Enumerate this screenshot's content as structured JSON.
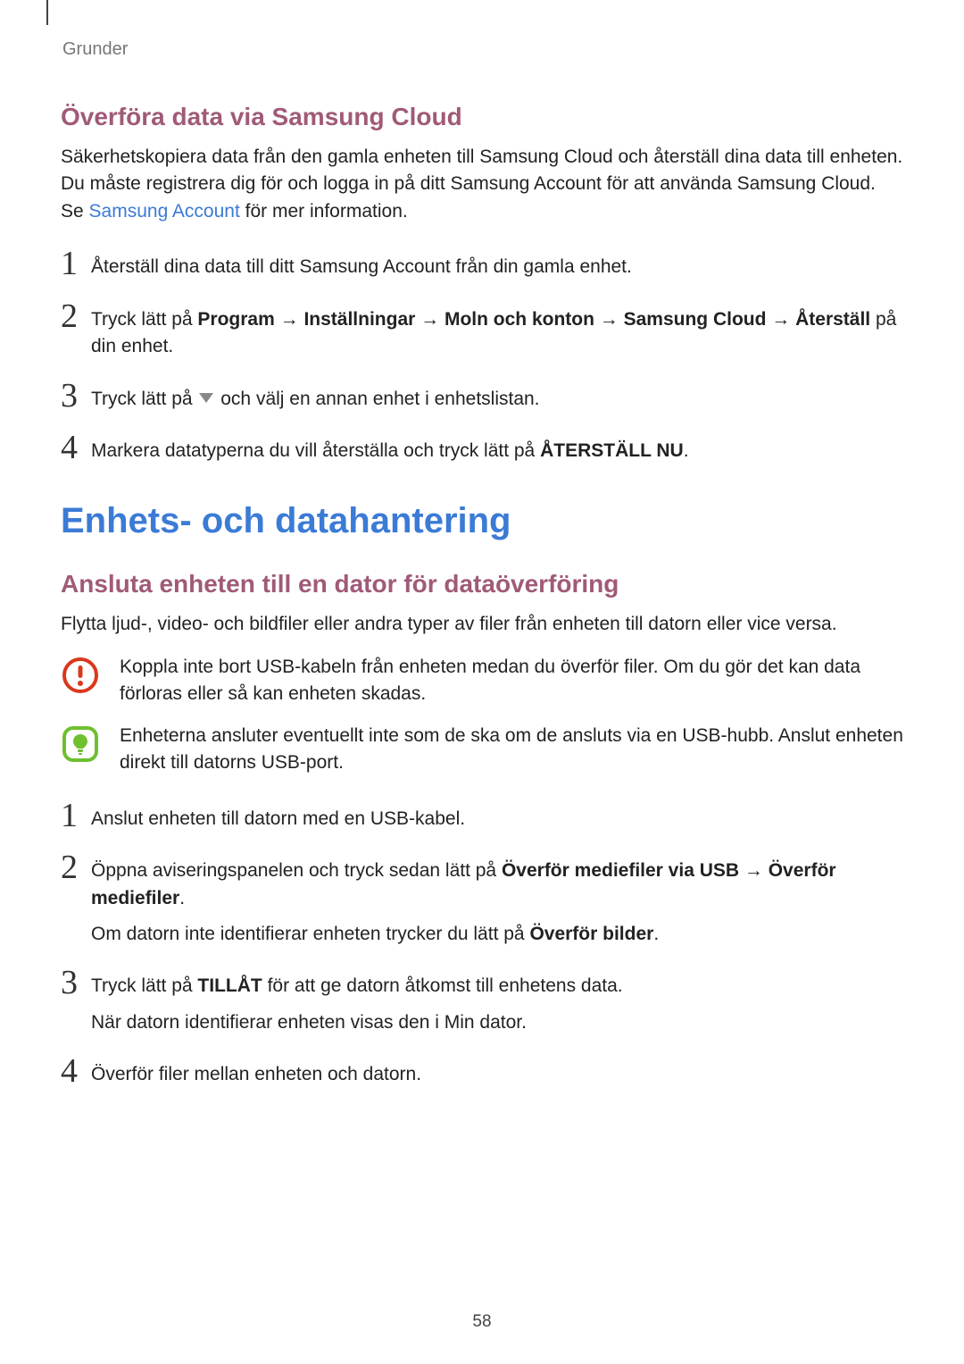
{
  "breadcrumb": "Grunder",
  "section1": {
    "heading": "Överföra data via Samsung Cloud",
    "intro_part1": "Säkerhetskopiera data från den gamla enheten till Samsung Cloud och återställ dina data till enheten. Du måste registrera dig för och logga in på ditt Samsung Account för att använda Samsung Cloud. Se ",
    "intro_link": "Samsung Account",
    "intro_part2": " för mer information.",
    "steps": {
      "s1": "Återställ dina data till ditt Samsung Account från din gamla enhet.",
      "s2_pre": "Tryck lätt på ",
      "s2_bold": "Program → Inställningar → Moln och konton → Samsung Cloud → Återställ",
      "s2_post": " på din enhet.",
      "s3_pre": "Tryck lätt på ",
      "s3_post": " och välj en annan enhet i enhetslistan.",
      "s4_pre": "Markera datatyperna du vill återställa och tryck lätt på ",
      "s4_bold": "ÅTERSTÄLL NU",
      "s4_post": "."
    }
  },
  "mainHeading": "Enhets- och datahantering",
  "section2": {
    "heading": "Ansluta enheten till en dator för dataöverföring",
    "intro": "Flytta ljud-, video- och bildfiler eller andra typer av filer från enheten till datorn eller vice versa.",
    "warning": "Koppla inte bort USB-kabeln från enheten medan du överför filer. Om du gör det kan data förloras eller så kan enheten skadas.",
    "note": "Enheterna ansluter eventuellt inte som de ska om de ansluts via en USB-hubb. Anslut enheten direkt till datorns USB-port.",
    "steps": {
      "s1": "Anslut enheten till datorn med en USB-kabel.",
      "s2_pre": "Öppna aviseringspanelen och tryck sedan lätt på ",
      "s2_bold": "Överför mediefiler via USB → Överför mediefiler",
      "s2_post": ".",
      "s2_extra_pre": "Om datorn inte identifierar enheten trycker du lätt på ",
      "s2_extra_bold": "Överför bilder",
      "s2_extra_post": ".",
      "s3_pre": "Tryck lätt på ",
      "s3_bold": "TILLÅT",
      "s3_post": " för att ge datorn åtkomst till enhetens data.",
      "s3_extra": "När datorn identifierar enheten visas den i Min dator.",
      "s4": "Överför filer mellan enheten och datorn."
    }
  },
  "pageNumber": "58"
}
